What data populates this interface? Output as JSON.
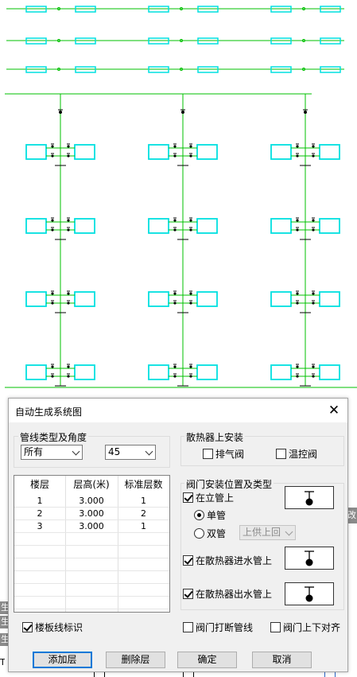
{
  "dialog": {
    "title": "自动生成系统图",
    "close_label": "✕"
  },
  "pipe_group": {
    "title": "管线类型及角度",
    "type_value": "所有",
    "angle_value": "45"
  },
  "radiator_group": {
    "title": "散热器上安装",
    "exhaust_valve_label": "排气阀",
    "exhaust_valve_checked": false,
    "temp_valve_label": "温控阀",
    "temp_valve_checked": false
  },
  "floor_table": {
    "headers": [
      "楼层",
      "层高(米)",
      "标准层数"
    ],
    "rows": [
      [
        "1",
        "3.000",
        "1"
      ],
      [
        "2",
        "3.000",
        "2"
      ],
      [
        "3",
        "3.000",
        "1"
      ]
    ]
  },
  "valve_group": {
    "title": "阀门安装位置及类型",
    "on_riser_label": "在立管上",
    "on_riser_checked": true,
    "single_pipe_label": "单管",
    "single_pipe_selected": true,
    "double_pipe_label": "双管",
    "double_pipe_selected": false,
    "supply_return_value": "上供上回",
    "on_radiator_inlet_label": "在散热器进水管上",
    "on_radiator_inlet_checked": true,
    "on_radiator_outlet_label": "在散热器出水管上",
    "on_radiator_outlet_checked": true
  },
  "options": {
    "floor_line_label": "楼板线标识",
    "floor_line_checked": true,
    "break_pipe_label": "阀门打断管线",
    "break_pipe_checked": false,
    "align_label": "阀门上下对齐",
    "align_checked": false
  },
  "buttons": {
    "add_floor": "添加层",
    "delete_floor": "删除层",
    "ok": "确定",
    "cancel": "取消"
  },
  "background_tabs": {
    "left_tab": "生",
    "right_tab": "改",
    "corner_text": "T"
  },
  "colors": {
    "pipe": "#00c000",
    "radiator": "#00e0e0",
    "valve": "#000000",
    "dialog_bg": "#f0f0f0",
    "focus_blue": "#0078d7"
  }
}
